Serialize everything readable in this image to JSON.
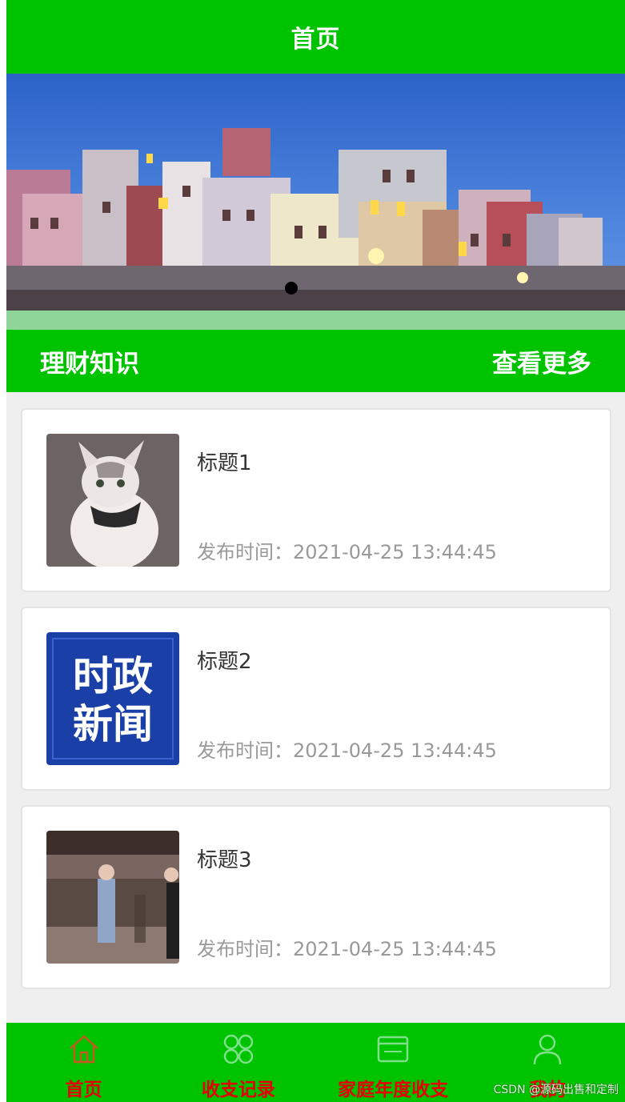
{
  "header": {
    "title": "首页"
  },
  "section": {
    "title": "理财知识",
    "more_label": "查看更多"
  },
  "articles": [
    {
      "title": "标题1",
      "time": "发布时间：2021-04-25 13:44:45",
      "thumb_icon": "cat-photo"
    },
    {
      "title": "标题2",
      "time": "发布时间：2021-04-25 13:44:45",
      "thumb_icon": "news-logo",
      "thumb_text_line1": "时政",
      "thumb_text_line2": "新闻"
    },
    {
      "title": "标题3",
      "time": "发布时间：2021-04-25 13:44:45",
      "thumb_icon": "stage-photo"
    }
  ],
  "tabs": [
    {
      "label": "首页",
      "icon": "home-icon"
    },
    {
      "label": "收支记录",
      "icon": "grid-icon"
    },
    {
      "label": "家庭年度收支",
      "icon": "calendar-icon"
    },
    {
      "label": "我的",
      "icon": "user-icon"
    }
  ],
  "watermark": "CSDN @源码出售和定制",
  "colors": {
    "brand_green": "#00c300",
    "tab_label_red": "#e60000"
  }
}
